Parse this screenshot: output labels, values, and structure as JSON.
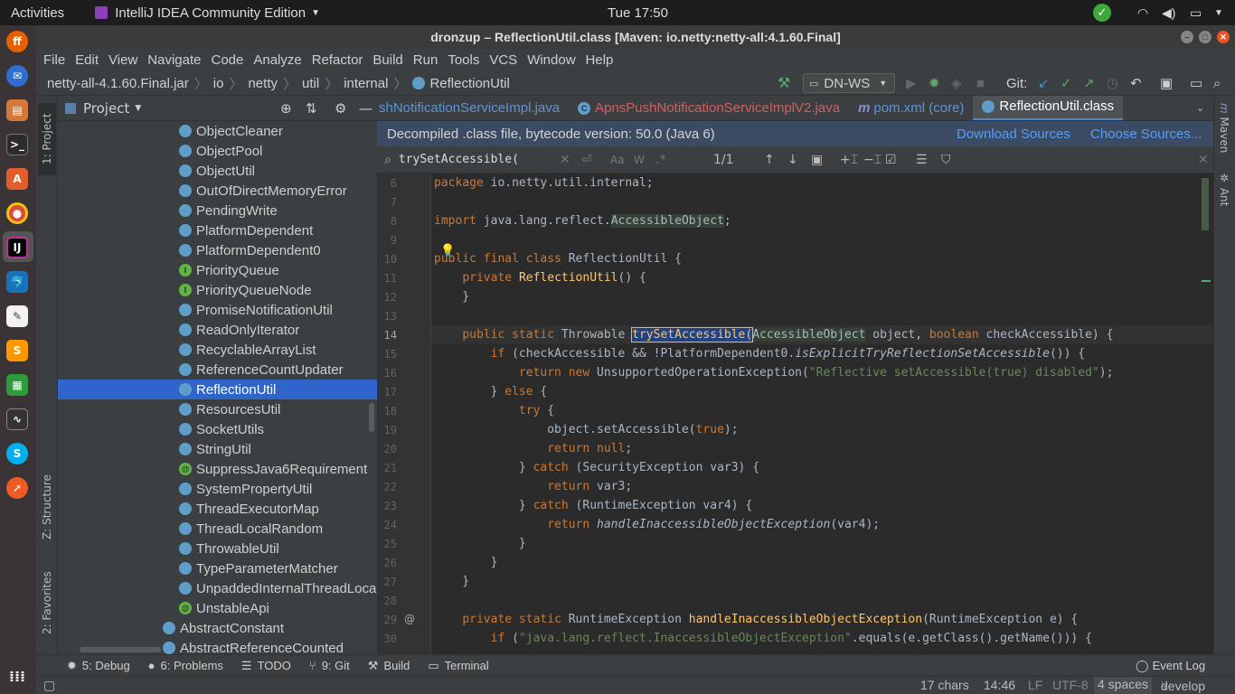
{
  "topbar": {
    "activities": "Activities",
    "app_name": "IntelliJ IDEA Community Edition",
    "clock": "Tue 17:50"
  },
  "window": {
    "title": "dronzup – ReflectionUtil.class [Maven: io.netty:netty-all:4.1.60.Final]"
  },
  "menu": [
    "File",
    "Edit",
    "View",
    "Navigate",
    "Code",
    "Analyze",
    "Refactor",
    "Build",
    "Run",
    "Tools",
    "VCS",
    "Window",
    "Help"
  ],
  "breadcrumbs": [
    "netty-all-4.1.60.Final.jar",
    "io",
    "netty",
    "util",
    "internal",
    "ReflectionUtil"
  ],
  "run_config": "DN-WS",
  "git_label": "Git:",
  "project_panel": {
    "title": "Project",
    "side_tabs": [
      "1: Project",
      "Z: Structure",
      "2: Favorites"
    ],
    "items": [
      {
        "name": "ObjectCleaner",
        "kind": "class"
      },
      {
        "name": "ObjectPool",
        "kind": "class"
      },
      {
        "name": "ObjectUtil",
        "kind": "class"
      },
      {
        "name": "OutOfDirectMemoryError",
        "kind": "class"
      },
      {
        "name": "PendingWrite",
        "kind": "class"
      },
      {
        "name": "PlatformDependent",
        "kind": "class"
      },
      {
        "name": "PlatformDependent0",
        "kind": "class"
      },
      {
        "name": "PriorityQueue",
        "kind": "interface"
      },
      {
        "name": "PriorityQueueNode",
        "kind": "interface"
      },
      {
        "name": "PromiseNotificationUtil",
        "kind": "class"
      },
      {
        "name": "ReadOnlyIterator",
        "kind": "class"
      },
      {
        "name": "RecyclableArrayList",
        "kind": "class"
      },
      {
        "name": "ReferenceCountUpdater",
        "kind": "class"
      },
      {
        "name": "ReflectionUtil",
        "kind": "class"
      },
      {
        "name": "ResourcesUtil",
        "kind": "class"
      },
      {
        "name": "SocketUtils",
        "kind": "class"
      },
      {
        "name": "StringUtil",
        "kind": "class"
      },
      {
        "name": "SuppressJava6Requirement",
        "kind": "annotation"
      },
      {
        "name": "SystemPropertyUtil",
        "kind": "class"
      },
      {
        "name": "ThreadExecutorMap",
        "kind": "class"
      },
      {
        "name": "ThreadLocalRandom",
        "kind": "class"
      },
      {
        "name": "ThrowableUtil",
        "kind": "class"
      },
      {
        "name": "TypeParameterMatcher",
        "kind": "class"
      },
      {
        "name": "UnpaddedInternalThreadLocalMap",
        "kind": "class"
      },
      {
        "name": "UnstableApi",
        "kind": "annotation"
      },
      {
        "name": "AbstractConstant",
        "kind": "class"
      },
      {
        "name": "AbstractReferenceCounted",
        "kind": "class"
      }
    ]
  },
  "tabs": [
    {
      "label": "shNotificationServiceImpl.java",
      "active": false
    },
    {
      "label": "ApnsPushNotificationServiceImplV2.java",
      "active": false
    },
    {
      "label": "pom.xml (core)",
      "active": false
    },
    {
      "label": "ReflectionUtil.class",
      "active": true
    }
  ],
  "decompiled": {
    "notice": "Decompiled .class file, bytecode version: 50.0 (Java 6)",
    "download": "Download Sources",
    "choose": "Choose Sources..."
  },
  "find": {
    "query": "trySetAccessible(",
    "count": "1/1"
  },
  "code_lines": [
    6,
    7,
    8,
    9,
    10,
    11,
    12,
    13,
    14,
    15,
    16,
    17,
    18,
    19,
    20,
    21,
    22,
    23,
    24,
    25,
    26,
    27,
    28,
    29,
    30
  ],
  "right_tabs": [
    "Maven",
    "Ant"
  ],
  "bottom_tools": [
    "5: Debug",
    "6: Problems",
    "TODO",
    "9: Git",
    "Build",
    "Terminal",
    "Event Log"
  ],
  "status": {
    "chars": "17 chars",
    "position": "14:46",
    "line_sep": "LF",
    "encoding": "UTF-8",
    "indent": "4 spaces",
    "branch": "develop"
  }
}
